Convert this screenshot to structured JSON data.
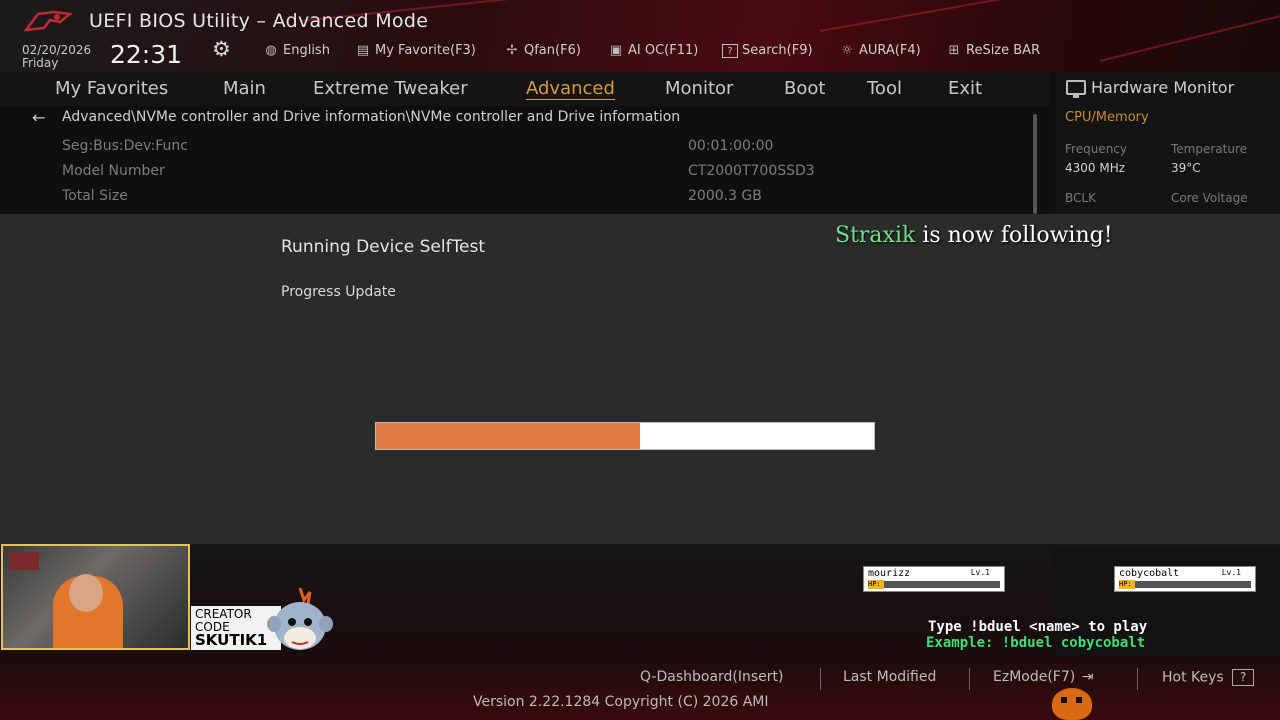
{
  "window": {
    "title": "UEFI BIOS Utility – Advanced Mode",
    "date": "02/20/2026",
    "day": "Friday",
    "time": "22:31"
  },
  "toolbar": [
    {
      "label": "English",
      "icon": "globe-icon"
    },
    {
      "label": "My Favorite(F3)",
      "icon": "favorite-icon"
    },
    {
      "label": "Qfan(F6)",
      "icon": "fan-icon"
    },
    {
      "label": "AI OC(F11)",
      "icon": "chip-icon"
    },
    {
      "label": "Search(F9)",
      "icon": "search-icon"
    },
    {
      "label": "AURA(F4)",
      "icon": "aura-icon"
    },
    {
      "label": "ReSize BAR",
      "icon": "resize-bar-icon"
    }
  ],
  "nav": {
    "tabs": [
      "My Favorites",
      "Main",
      "Extreme Tweaker",
      "Advanced",
      "Monitor",
      "Boot",
      "Tool",
      "Exit"
    ],
    "active": "Advanced"
  },
  "content": {
    "breadcrumb": "Advanced\\NVMe controller and Drive information\\NVMe controller and Drive information",
    "rows": [
      {
        "label": "Seg:Bus:Dev:Func",
        "value": "00:01:00:00"
      },
      {
        "label": "Model Number",
        "value": "CT2000T700SSD3"
      },
      {
        "label": "Total Size",
        "value": "2000.3 GB"
      }
    ]
  },
  "hardware_monitor": {
    "title": "Hardware Monitor",
    "section": "CPU/Memory",
    "frequency_label": "Frequency",
    "frequency_value": "4300 MHz",
    "temperature_label": "Temperature",
    "temperature_value": "39°C",
    "bclk_label": "BCLK",
    "core_voltage_label": "Core Voltage"
  },
  "dialog": {
    "title": "Running Device SelfTest",
    "subtitle": "Progress Update",
    "progress": 0.53
  },
  "overlay": {
    "follow_name": "Straxik",
    "follow_text": " is now following!",
    "creator_line1": "CREATOR",
    "creator_line2": "CODE",
    "creator_code": "SKUTIK1",
    "duel_players": [
      {
        "name": "mourizz",
        "level": "Lv.1",
        "hp_label": "HP:",
        "hp": 0.12
      },
      {
        "name": "cobycobalt",
        "level": "Lv.1",
        "hp_label": "HP:",
        "hp": 0.0
      }
    ],
    "duel_line1": "Type !bduel <name> to play",
    "duel_line2": "Example: !bduel cobycobalt"
  },
  "footer": {
    "q_dashboard": "Q-Dashboard(Insert)",
    "last_modified": "Last Modified",
    "ezmode": "EzMode(F7)",
    "hot_keys": "Hot Keys",
    "hot_keys_icon": "?",
    "version": "Version 2.22.1284 Copyright (C) 2026 AMI"
  },
  "colors": {
    "accent": "#d99a3b",
    "progress_fill": "#e37b45",
    "follow_name": "#6fe08c",
    "example_text": "#3fe071"
  }
}
